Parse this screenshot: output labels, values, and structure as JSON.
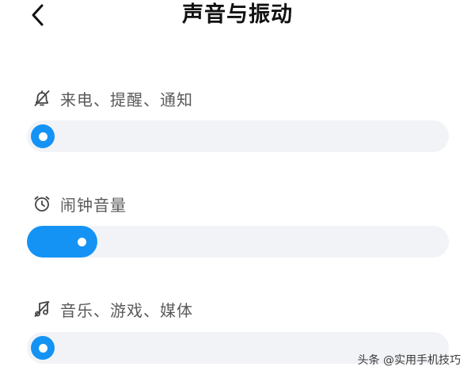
{
  "header": {
    "title": "声音与振动",
    "back_icon": "chevron-left-icon"
  },
  "accent_color": "#1493f5",
  "track_color": "#f2f3f6",
  "rows": [
    {
      "icon": "bell-off-icon",
      "label": "来电、提醒、通知",
      "level": 0.0
    },
    {
      "icon": "alarm-clock-icon",
      "label": "闹钟音量",
      "level": 0.1
    },
    {
      "icon": "music-off-icon",
      "label": "音乐、游戏、媒体",
      "level": 0.0
    }
  ],
  "watermark": "头条 @实用手机技巧"
}
